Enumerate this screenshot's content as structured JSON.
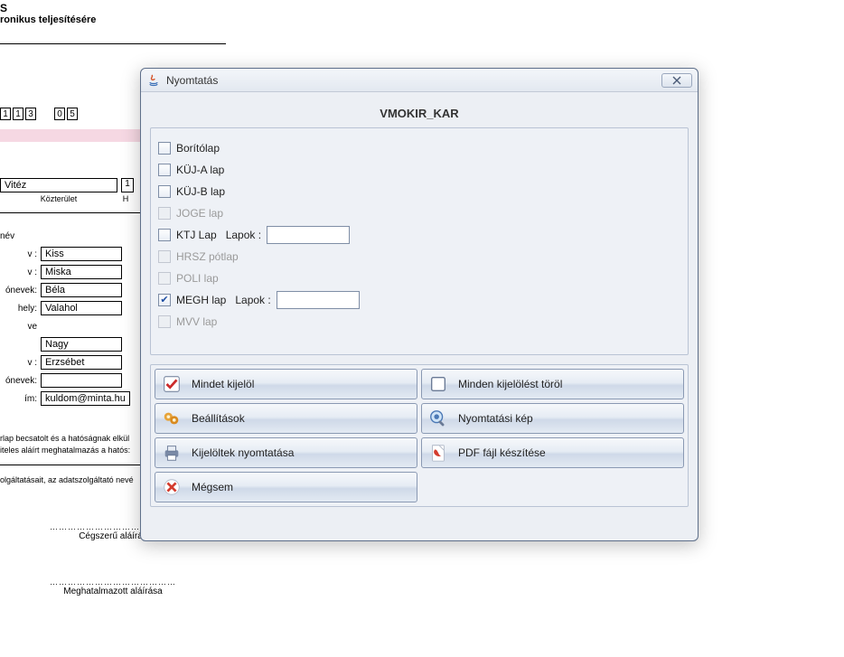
{
  "background": {
    "header_suffix": "S",
    "subheader": "ronikus teljesítésére",
    "digits_a": [
      "1",
      "1",
      "3"
    ],
    "digits_b": [
      "0",
      "5"
    ],
    "top_field_value": "Vitéz",
    "top_field_right_suffix": "1",
    "kozterulet": "Közterület",
    "h_suffix": "H",
    "nev_label": "név",
    "rows": [
      {
        "label": "v :",
        "value": "Kiss"
      },
      {
        "label": "v :",
        "value": "Miska"
      },
      {
        "label": "ónevek:",
        "value": "Béla"
      },
      {
        "label": "hely:",
        "value": "Valahol"
      },
      {
        "label": "ve",
        "value": ""
      },
      {
        "label": "",
        "value": "Nagy"
      },
      {
        "label": "v :",
        "value": "Erzsébet"
      },
      {
        "label": "ónevek:",
        "value": ""
      },
      {
        "label": "ím:",
        "value": "kuldom@minta.hu"
      }
    ],
    "footer1": "rlap becsatolt és a hatóságnak elkül",
    "footer2": "iteles aláírt meghatalmazás a hatós:",
    "footer3": "olgáltatásait, az adatszolgáltató nevé",
    "sig1": "Cégszerű aláírás",
    "sig2": "Meghatalmazott aláírása",
    "dots": "……………………………………"
  },
  "dialog": {
    "title": "Nyomtatás",
    "section": "VMOKIR_KAR",
    "items": [
      {
        "label": "Borítólap",
        "enabled": true,
        "checked": false,
        "has_lapok": false
      },
      {
        "label": "KÜJ-A lap",
        "enabled": true,
        "checked": false,
        "has_lapok": false
      },
      {
        "label": "KÜJ-B lap",
        "enabled": true,
        "checked": false,
        "has_lapok": false
      },
      {
        "label": "JOGE lap",
        "enabled": false,
        "checked": false,
        "has_lapok": false
      },
      {
        "label": "KTJ Lap",
        "enabled": true,
        "checked": false,
        "has_lapok": true,
        "lapok_value": ""
      },
      {
        "label": "HRSZ pótlap",
        "enabled": false,
        "checked": false,
        "has_lapok": false
      },
      {
        "label": "POLI lap",
        "enabled": false,
        "checked": false,
        "has_lapok": false
      },
      {
        "label": "MEGH lap",
        "enabled": true,
        "checked": true,
        "has_lapok": true,
        "lapok_value": ""
      },
      {
        "label": "MVV lap",
        "enabled": false,
        "checked": false,
        "has_lapok": false
      }
    ],
    "lapok_label": "Lapok :",
    "buttons": {
      "select_all": "Mindet kijelöl",
      "clear_all": "Minden kijelölést töröl",
      "settings": "Beállítások",
      "preview": "Nyomtatási kép",
      "print_selected": "Kijelöltek nyomtatása",
      "pdf": "PDF fájl készítése",
      "cancel": "Mégsem"
    }
  }
}
